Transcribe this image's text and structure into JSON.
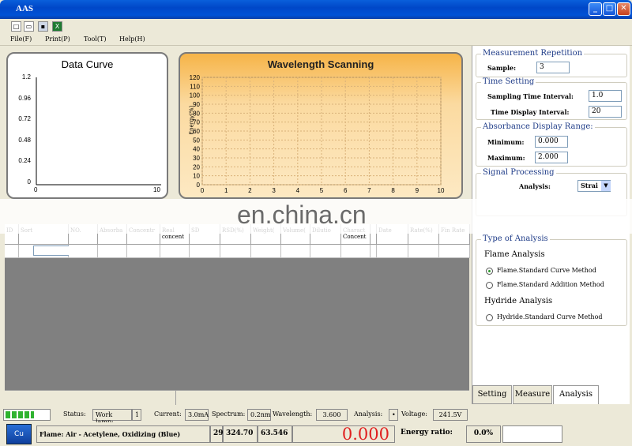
{
  "window": {
    "title": "AAS"
  },
  "menu": {
    "file": "File(F)",
    "print": "Print(P)",
    "tool": "Tool(T)",
    "help": "Help(H)"
  },
  "data_curve": {
    "title": "Data Curve",
    "yticks": [
      "1.2",
      "0.96",
      "0.72",
      "0.48",
      "0.24",
      "0"
    ],
    "xticks": [
      "0",
      "10"
    ]
  },
  "wavelength": {
    "title": "Wavelength Scanning",
    "ylabel": "Energy(%)",
    "yticks": [
      "120",
      "110",
      "100",
      "90",
      "80",
      "70",
      "60",
      "50",
      "40",
      "30",
      "20",
      "10",
      "0"
    ],
    "xticks": [
      "0",
      "1",
      "2",
      "3",
      "4",
      "5",
      "6",
      "7",
      "8",
      "9",
      "10"
    ]
  },
  "measurement": {
    "title": "Measurement Repetition",
    "sample_label": "Sample:",
    "sample_value": "3"
  },
  "time": {
    "title": "Time Setting",
    "sampling_label": "Sampling Time Interval:",
    "sampling_value": "1.0",
    "display_label": "Time Display Interval:",
    "display_value": "20"
  },
  "absorbance": {
    "title": "Absorbance Display Range:",
    "min_label": "Minimum:",
    "min_value": "0.000",
    "max_label": "Maximum:",
    "max_value": "2.000"
  },
  "signal": {
    "title": "Signal Processing",
    "analysis_label": "Analysis:",
    "analysis_value": "Strai"
  },
  "analysis_type": {
    "title": "Type of Analysis",
    "flame_heading": "Flame Analysis",
    "opt1": "Flame.Standard Curve Method",
    "opt2": "Flame.Standard Addition Method",
    "hydride_heading": "Hydride Analysis",
    "opt3": "Hydride.Standard Curve Method"
  },
  "tabs": {
    "setting": "Setting",
    "measure": "Measure",
    "analysis": "Analysis"
  },
  "table": {
    "headers": [
      "ID",
      "Sort",
      "NO.",
      "Absorba",
      "Concentr",
      "Real concent",
      "SD",
      "RSD(%)",
      "Weight(",
      "Volume(",
      "Dilutio",
      "Charact Concent",
      "",
      "Date",
      "Rate(%)",
      "Fin Rate"
    ]
  },
  "status": {
    "status_label": "Status:",
    "lamp": "Work lamp:",
    "lamp_val": "1",
    "current_label": "Current:",
    "current_val": "3.0mA",
    "spectrum_label": "Spectrum:",
    "spectrum_val": "0.2nm",
    "wavelength_label": "Wavelength:",
    "wavelength_val": "3.600",
    "analysis_label": "Analysis:",
    "analysis_val": "•",
    "voltage_label": "Voltage:",
    "voltage_val": "241.5V"
  },
  "bottom": {
    "flame": "Flame: Air - Acetylene, Oxidizing (Blue)",
    "num1": "29",
    "num2": "324.70",
    "num3": "63.546",
    "reading": "0.000",
    "energy_label": "Energy ratio:",
    "energy_val": "0.0%"
  },
  "watermark": "en.china.cn"
}
